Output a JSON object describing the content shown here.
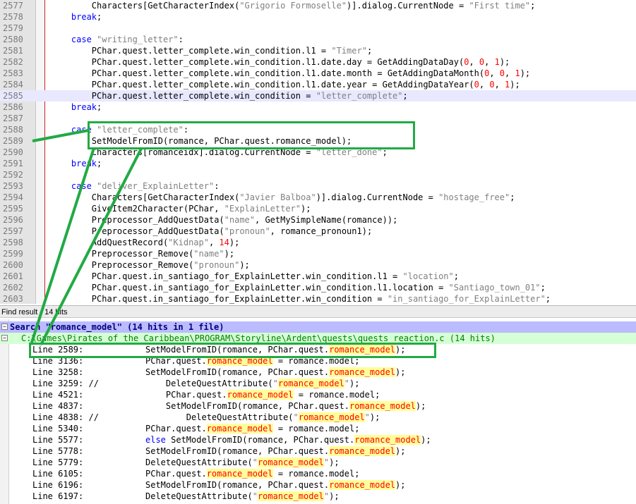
{
  "editor": {
    "lines": [
      {
        "n": "2577",
        "c": "        Characters[GetCharacterIndex(\"Grigorio Formoselle\")].dialog.CurrentNode = \"First time\";"
      },
      {
        "n": "2578",
        "c": "    break;"
      },
      {
        "n": "2579",
        "c": ""
      },
      {
        "n": "2580",
        "c": "    case \"writing_letter\":"
      },
      {
        "n": "2581",
        "c": "        PChar.quest.letter_complete.win_condition.l1 = \"Timer\";"
      },
      {
        "n": "2582",
        "c": "        PChar.quest.letter_complete.win_condition.l1.date.day = GetAddingDataDay(0, 0, 1);"
      },
      {
        "n": "2583",
        "c": "        PChar.quest.letter_complete.win_condition.l1.date.month = GetAddingDataMonth(0, 0, 1);"
      },
      {
        "n": "2584",
        "c": "        PChar.quest.letter_complete.win_condition.l1.date.year = GetAddingDataYear(0, 0, 1);"
      },
      {
        "n": "2585",
        "c": "        PChar.quest.letter_complete.win_condition = \"letter_complete\";",
        "current": true
      },
      {
        "n": "2586",
        "c": "    break;"
      },
      {
        "n": "2587",
        "c": ""
      },
      {
        "n": "2588",
        "c": "    case \"letter_complete\":"
      },
      {
        "n": "2589",
        "c": "        SetModelFromID(romance, PChar.quest.romance_model);"
      },
      {
        "n": "2590",
        "c": "        Characters[romanceidx].dialog.CurrentNode = \"letter_done\";"
      },
      {
        "n": "2591",
        "c": "    break;"
      },
      {
        "n": "2592",
        "c": ""
      },
      {
        "n": "2593",
        "c": "    case \"deliver_ExplainLetter\":"
      },
      {
        "n": "2594",
        "c": "        Characters[GetCharacterIndex(\"Javier Balboa\")].dialog.CurrentNode = \"hostage_free\";"
      },
      {
        "n": "2595",
        "c": "        GiveItem2Character(PChar, \"ExplainLetter\");"
      },
      {
        "n": "2596",
        "c": "        Preprocessor_AddQuestData(\"name\", GetMySimpleName(romance));"
      },
      {
        "n": "2597",
        "c": "        Preprocessor_AddQuestData(\"pronoun\", romance_pronoun1);"
      },
      {
        "n": "2598",
        "c": "        AddQuestRecord(\"Kidnap\", 14);"
      },
      {
        "n": "2599",
        "c": "        Preprocessor_Remove(\"name\");"
      },
      {
        "n": "2600",
        "c": "        Preprocessor_Remove(\"pronoun\");"
      },
      {
        "n": "2601",
        "c": "        PChar.quest.in_santiago_for_ExplainLetter.win_condition.l1 = \"location\";"
      },
      {
        "n": "2602",
        "c": "        PChar.quest.in_santiago_for_ExplainLetter.win_condition.l1.location = \"Santiago_town_01\";"
      },
      {
        "n": "2603",
        "c": "        PChar.quest.in_santiago_for_ExplainLetter.win_condition = \"in_santiago_for_ExplainLetter\";"
      }
    ]
  },
  "find_result": {
    "title": "Find result - 14 hits",
    "search_line": "Search \"romance_model\" (14 hits in 1 file)",
    "file_line": "C:\\Games\\Pirates of the Caribbean\\PROGRAM\\Storyline\\Ardent\\quests\\quests_reaction.c (14 hits)",
    "search_term": "romance_model",
    "hits": [
      {
        "line": "Line 2589:",
        "code": "SetModelFromID(romance, PChar.quest.romance_model);"
      },
      {
        "line": "Line 3136:",
        "code": "PChar.quest.romance_model = romance.model;"
      },
      {
        "line": "Line 3258:",
        "code": "SetModelFromID(romance, PChar.quest.romance_model);"
      },
      {
        "line": "Line 3259: //",
        "code": "    DeleteQuestAttribute(\"romance_model\");"
      },
      {
        "line": "Line 4521:",
        "code": "    PChar.quest.romance_model = romance.model;"
      },
      {
        "line": "Line 4837:",
        "code": "    SetModelFromID(romance, PChar.quest.romance_model);"
      },
      {
        "line": "Line 4838: //",
        "code": "        DeleteQuestAttribute(\"romance_model\");"
      },
      {
        "line": "Line 5340:",
        "code": "PChar.quest.romance_model = romance.model;"
      },
      {
        "line": "Line 5577:",
        "code": "else SetModelFromID(romance, PChar.quest.romance_model);"
      },
      {
        "line": "Line 5778:",
        "code": "SetModelFromID(romance, PChar.quest.romance_model);"
      },
      {
        "line": "Line 5779:",
        "code": "DeleteQuestAttribute(\"romance_model\");"
      },
      {
        "line": "Line 6105:",
        "code": "PChar.quest.romance_model = romance.model;"
      },
      {
        "line": "Line 6196:",
        "code": "SetModelFromID(romance, PChar.quest.romance_model);"
      },
      {
        "line": "Line 6197:",
        "code": "DeleteQuestAttribute(\"romance_model\");"
      }
    ]
  },
  "colors": {
    "annotation_green": "#22aa44",
    "keyword": "#0000ff",
    "string": "#808080",
    "number": "#ff0000",
    "match_highlight": "#ffff99",
    "search_header_bg": "#bbbbff",
    "file_header_bg": "#d5ffd5"
  }
}
